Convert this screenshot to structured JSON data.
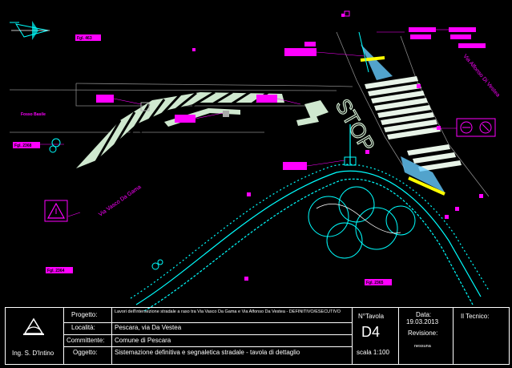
{
  "plan": {
    "labels": {
      "foglio_top": "Fgl. 463",
      "fosso": "Fosso Basile",
      "foglio_left": "Fgl. 2368",
      "foglio_bottom_left": "Fgl. 2364",
      "foglio_bottom_right": "Fgl. 2365",
      "street_left": "Via Vasco Da Gama",
      "street_right": "Via Alfonso Di Vestea",
      "stop": "STOP"
    }
  },
  "title_block": {
    "author": "Ing. S. D'Intino",
    "progetto_label": "Progetto:",
    "progetto_value": "Lavori dell'intersezione stradale a raso tra Via Vasco Da Gama e Via Alfonso Da Vestea - DEFINITIVO/ESECUTIVO",
    "localita_label": "Località:",
    "localita_value": "Pescara, via Da Vestea",
    "committente_label": "Committente:",
    "committente_value": "Comune di Pescara",
    "oggetto_label": "Oggetto:",
    "oggetto_value": "Sistemazione definitiva e segnaletica stradale - tavola di dettaglio",
    "tavola_label": "N°Tavola",
    "tavola_value": "D4",
    "scala": "scala 1:100",
    "data_label": "Data:",
    "data_value": "19.03.2013",
    "revisione_label": "Revisione:",
    "revisione_value": "nessuna",
    "tecnico_label": "Il Tecnico:"
  },
  "colors": {
    "background": "#000000",
    "annotation": "#ff00ff",
    "kerb": "#00ffff",
    "stripes": "#cfe8cf",
    "yellow_bar": "#ffff00"
  }
}
